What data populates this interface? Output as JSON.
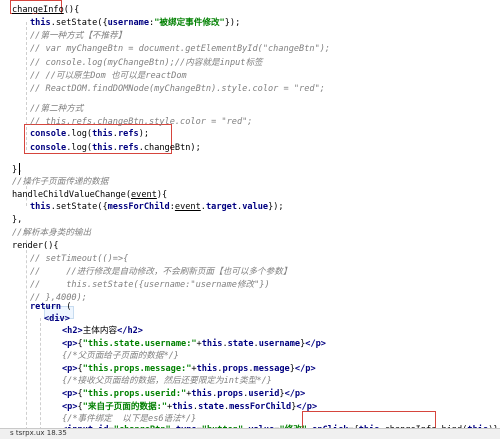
{
  "colors": {
    "keyword": "#000080",
    "string": "#008000",
    "comment": "#808080",
    "highlight_box": "#d6453d"
  },
  "code": [
    {
      "tokens": [
        [
          "fn",
          "changeInfo"
        ],
        [
          "plain",
          "(){"
        ]
      ]
    },
    {
      "tokens": [
        [
          "kw",
          "this"
        ],
        [
          "plain",
          ".setState({"
        ],
        [
          "kw",
          "username"
        ],
        [
          "plain",
          ":"
        ],
        [
          "str",
          "\"被绑定事件修改\""
        ],
        [
          "plain",
          "});"
        ]
      ]
    },
    {
      "tokens": [
        [
          "cmt",
          "//第一种方式【不推荐】"
        ]
      ]
    },
    {
      "tokens": [
        [
          "cmt",
          "// var myChangeBtn = document.getElementById(\"changeBtn\");"
        ]
      ]
    },
    {
      "tokens": [
        [
          "cmt",
          "// console.log(myChangeBtn);//内容就是input标签"
        ]
      ]
    },
    {
      "tokens": [
        [
          "cmt",
          "// //可以原生Dom 也可以是reactDom"
        ]
      ]
    },
    {
      "tokens": [
        [
          "cmt",
          "// ReactDOM.findDOMNode(myChangeBtn).style.color = \"red\";"
        ]
      ]
    },
    {
      "tokens": [
        [
          "cmt",
          "//第二种方式"
        ]
      ]
    },
    {
      "tokens": [
        [
          "cmt",
          "// this.refs.changeBtn.style.color = \"red\";"
        ]
      ]
    },
    {
      "tokens": [
        [
          "kw",
          "console"
        ],
        [
          "plain",
          ".log("
        ],
        [
          "kw",
          "this"
        ],
        [
          "plain",
          "."
        ],
        [
          "kw",
          "refs"
        ],
        [
          "plain",
          ");"
        ]
      ]
    },
    {
      "tokens": [
        [
          "kw",
          "console"
        ],
        [
          "plain",
          ".log("
        ],
        [
          "kw",
          "this"
        ],
        [
          "plain",
          "."
        ],
        [
          "kw",
          "refs"
        ],
        [
          "plain",
          ".changeBtn);"
        ]
      ]
    },
    {
      "tokens": []
    },
    {
      "tokens": [
        [
          "plain",
          "},"
        ]
      ]
    },
    {
      "tokens": [
        [
          "cmt",
          "//操作子页面传递的数据"
        ]
      ]
    },
    {
      "tokens": [
        [
          "plain",
          "handleChildValueChange("
        ],
        [
          "fn",
          "event"
        ],
        [
          "plain",
          "){"
        ]
      ]
    },
    {
      "tokens": [
        [
          "kw",
          "this"
        ],
        [
          "plain",
          ".setState({"
        ],
        [
          "kw",
          "messForChild"
        ],
        [
          "plain",
          ":"
        ],
        [
          "fn",
          "event"
        ],
        [
          "plain",
          "."
        ],
        [
          "kw",
          "target"
        ],
        [
          "plain",
          "."
        ],
        [
          "kw",
          "value"
        ],
        [
          "plain",
          "});"
        ]
      ]
    },
    {
      "tokens": [
        [
          "plain",
          "},"
        ]
      ]
    },
    {
      "tokens": [
        [
          "cmt",
          "//解析本身类的输出"
        ]
      ]
    },
    {
      "tokens": [
        [
          "plain",
          "render(){"
        ]
      ]
    },
    {
      "tokens": [
        [
          "cmt",
          "// setTimeout(()=>{"
        ]
      ]
    },
    {
      "tokens": [
        [
          "cmt",
          "//     //进行修改是自动修改，不会刷新页面【也可以多个参数】"
        ]
      ]
    },
    {
      "tokens": [
        [
          "cmt",
          "//     this.setState({username:\"username修改\"})"
        ]
      ]
    },
    {
      "tokens": [
        [
          "cmt",
          "// },4000);"
        ]
      ]
    },
    {
      "tokens": [
        [
          "kw",
          "return"
        ],
        [
          "plain",
          " ("
        ]
      ]
    },
    {
      "tokens": [
        [
          "kw",
          "<div>"
        ]
      ]
    },
    {
      "tokens": [
        [
          "kw",
          "<h2>"
        ],
        [
          "plain",
          "主体内容"
        ],
        [
          "kw",
          "</h2>"
        ]
      ]
    },
    {
      "tokens": [
        [
          "kw",
          "<p>"
        ],
        [
          "plain",
          "{"
        ],
        [
          "str",
          "\"this.state.username:\""
        ],
        [
          "plain",
          "+"
        ],
        [
          "kw",
          "this"
        ],
        [
          "plain",
          "."
        ],
        [
          "kw",
          "state"
        ],
        [
          "plain",
          "."
        ],
        [
          "kw",
          "username"
        ],
        [
          "plain",
          "}"
        ],
        [
          "kw",
          "</p>"
        ]
      ]
    },
    {
      "tokens": [
        [
          "cmt",
          "{/*父页面给子页面的数据*/}"
        ]
      ]
    },
    {
      "tokens": [
        [
          "kw",
          "<p>"
        ],
        [
          "plain",
          "{"
        ],
        [
          "str",
          "\"this.props.message:\""
        ],
        [
          "plain",
          "+"
        ],
        [
          "kw",
          "this"
        ],
        [
          "plain",
          "."
        ],
        [
          "kw",
          "props"
        ],
        [
          "plain",
          "."
        ],
        [
          "kw",
          "message"
        ],
        [
          "plain",
          "}"
        ],
        [
          "kw",
          "</p>"
        ]
      ]
    },
    {
      "tokens": [
        [
          "cmt",
          "{/*接收父页面给的数据，然后还要限定为int类型*/}"
        ]
      ]
    },
    {
      "tokens": [
        [
          "kw",
          "<p>"
        ],
        [
          "plain",
          "{"
        ],
        [
          "str",
          "\"this.props.userid:\""
        ],
        [
          "plain",
          "+"
        ],
        [
          "kw",
          "this"
        ],
        [
          "plain",
          "."
        ],
        [
          "kw",
          "props"
        ],
        [
          "plain",
          "."
        ],
        [
          "kw",
          "userid"
        ],
        [
          "plain",
          "}"
        ],
        [
          "kw",
          "</p>"
        ]
      ]
    },
    {
      "tokens": [
        [
          "kw",
          "<p>"
        ],
        [
          "plain",
          "{"
        ],
        [
          "str",
          "\"来自子页面的数据:\""
        ],
        [
          "plain",
          "+"
        ],
        [
          "kw",
          "this"
        ],
        [
          "plain",
          "."
        ],
        [
          "kw",
          "state"
        ],
        [
          "plain",
          "."
        ],
        [
          "kw",
          "messForChild"
        ],
        [
          "plain",
          "}"
        ],
        [
          "kw",
          "</p>"
        ]
      ]
    },
    {
      "tokens": [
        [
          "cmt",
          "{/*事件绑定  以下是es6语法*/}"
        ]
      ]
    },
    {
      "tokens": [
        [
          "kw",
          "<input"
        ],
        [
          "plain",
          " "
        ],
        [
          "kw",
          "id"
        ],
        [
          "plain",
          "="
        ],
        [
          "str",
          "\"changeBtn\""
        ],
        [
          "plain",
          " "
        ],
        [
          "kw",
          "type"
        ],
        [
          "plain",
          "="
        ],
        [
          "str",
          "\"button\""
        ],
        [
          "plain",
          " "
        ],
        [
          "kw",
          "value"
        ],
        [
          "plain",
          "="
        ],
        [
          "str",
          "\"修改\""
        ],
        [
          "plain",
          " "
        ],
        [
          "kw",
          "onClick"
        ],
        [
          "plain",
          "={"
        ],
        [
          "kw",
          "this"
        ],
        [
          "plain",
          ".changeInfo.bind("
        ],
        [
          "kw",
          "this"
        ],
        [
          "plain",
          ")}"
        ],
        [
          "kw",
          "/>"
        ]
      ]
    }
  ],
  "status": {
    "text": "s tsrpx.ux  18.35"
  }
}
